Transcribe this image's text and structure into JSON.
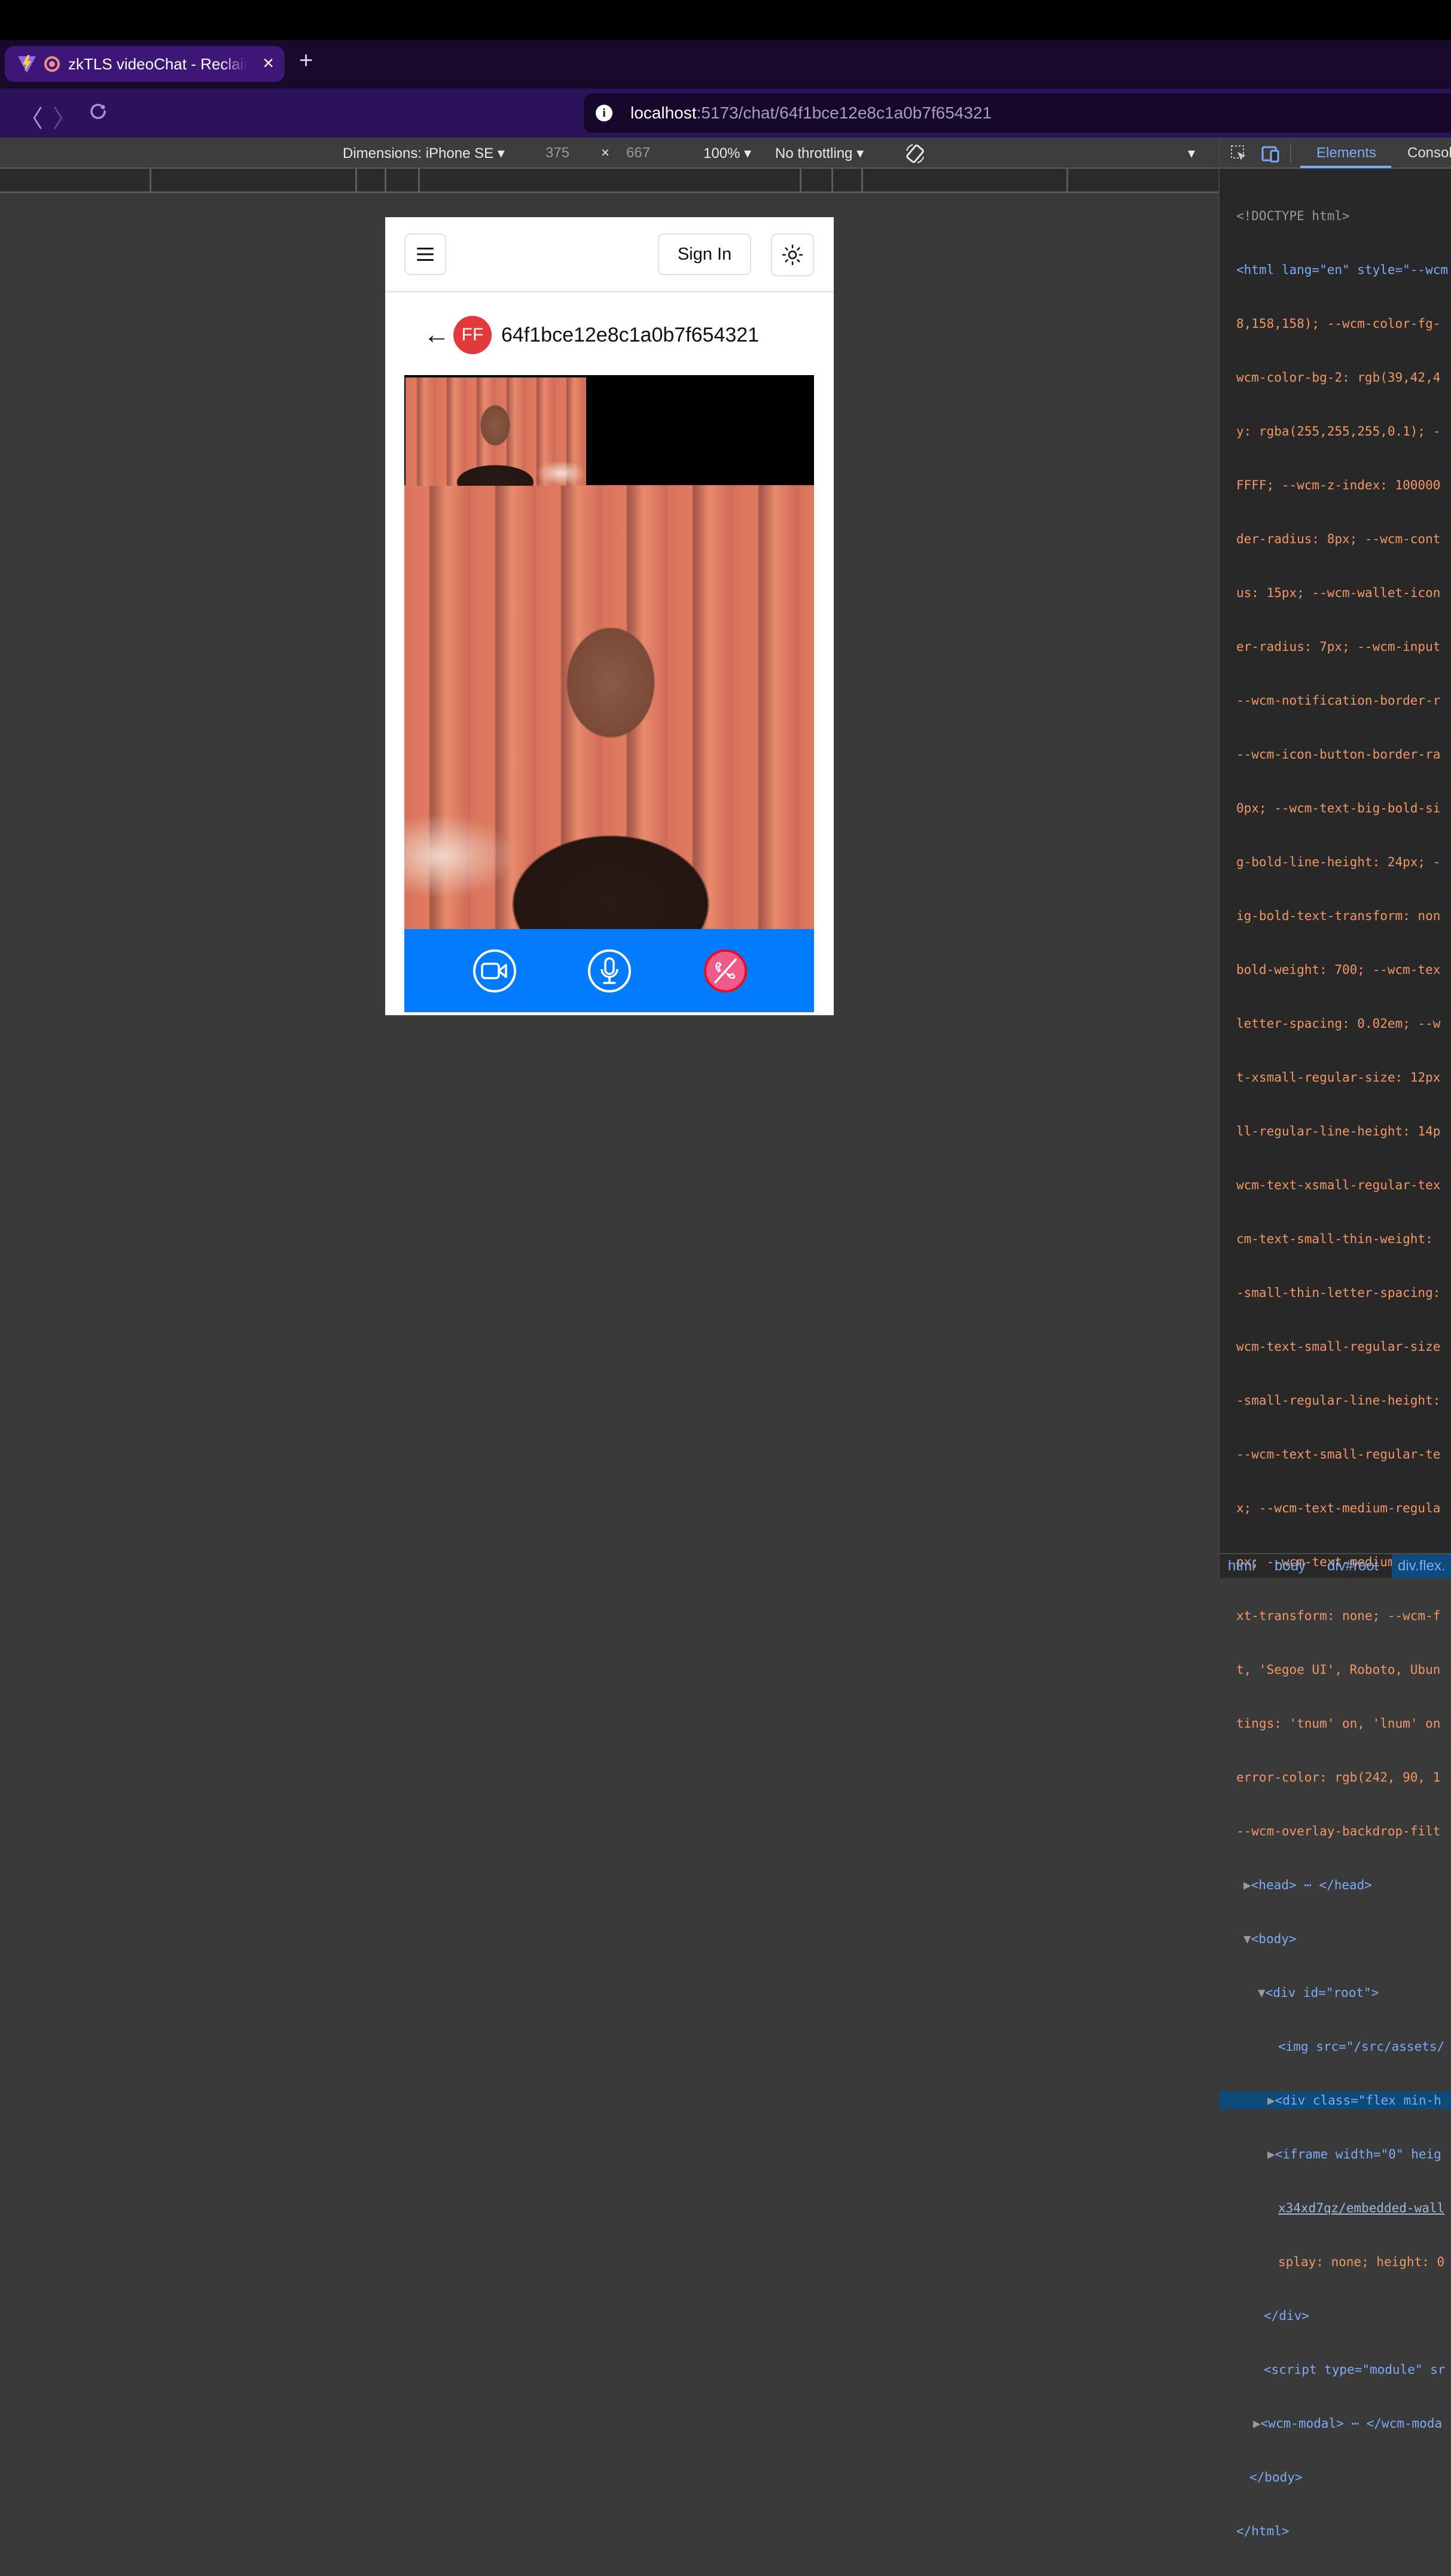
{
  "browser": {
    "tab": {
      "title": "zkTLS videoChat - Reclaim",
      "close_label": "×"
    },
    "new_tab_label": "+",
    "address": {
      "host": "localhost",
      "path": ":5173/chat/64f1bce12e8c1a0b7f654321"
    }
  },
  "device_toolbar": {
    "dimensions_label": "Dimensions: iPhone SE ▾",
    "width": "375",
    "times": "×",
    "height": "667",
    "zoom": "100% ▾",
    "throttling": "No throttling ▾",
    "more": "▾"
  },
  "app": {
    "header": {
      "sign_in_label": "Sign In"
    },
    "chat": {
      "avatar_initials": "FF",
      "chat_id": "64f1bce12e8c1a0b7f654321",
      "back_label": "←"
    },
    "controls": {
      "video": "video-camera",
      "mic": "microphone",
      "end_call": "end-call"
    },
    "colors": {
      "control_bar": "#037bfe",
      "avatar": "#e2393a",
      "end_call": "#ee5b8b"
    }
  },
  "devtools": {
    "tabs": [
      "Elements",
      "Consol"
    ],
    "code_lines": [
      "<!DOCTYPE html>",
      "<html lang=\"en\" style=\"--wcm",
      "8,158,158); --wcm-color-fg-",
      "wcm-color-bg-2: rgb(39,42,4",
      "y: rgba(255,255,255,0.1); -",
      "FFFF; --wcm-z-index: 100000",
      "der-radius: 8px; --wcm-cont",
      "us: 15px; --wcm-wallet-icon",
      "er-radius: 7px; --wcm-input",
      "--wcm-notification-border-r",
      "--wcm-icon-button-border-ra",
      "0px; --wcm-text-big-bold-si",
      "g-bold-line-height: 24px; -",
      "ig-bold-text-transform: non",
      "bold-weight: 700; --wcm-tex",
      "letter-spacing: 0.02em; --w",
      "t-xsmall-regular-size: 12px",
      "ll-regular-line-height: 14p",
      "wcm-text-xsmall-regular-tex",
      "cm-text-small-thin-weight: ",
      "-small-thin-letter-spacing:",
      "wcm-text-small-regular-size",
      "-small-regular-line-height:",
      "--wcm-text-small-regular-te",
      "x; --wcm-text-medium-regula",
      "px; --wcm-text-medium-regul",
      "xt-transform: none; --wcm-f",
      "t, 'Segoe UI', Roboto, Ubun",
      "tings: 'tnum' on, 'lnum' on",
      "error-color: rgb(242, 90, 1",
      "--wcm-overlay-backdrop-filt"
    ],
    "tree": {
      "head": "<head>",
      "head_close": "</head>",
      "body": "<body>",
      "root": "<div id=\"root\">",
      "img": "<img src=\"/src/assets/",
      "div_flex": "<div class=\"flex min-h",
      "iframe": "<iframe width=\"0\" heig",
      "iframe_2": "x34xd7qz/embedded-wall",
      "iframe_3": "splay: none; height: 0",
      "div_close": "</div>",
      "script": "<script type=\"module\" sr",
      "wcm": "<wcm-modal>",
      "wcm_close": "</wcm-moda",
      "body_close": "</body>",
      "html_close": "</html>"
    },
    "breadcrumbs": [
      "html",
      "body",
      "div#root",
      "div.flex."
    ]
  }
}
